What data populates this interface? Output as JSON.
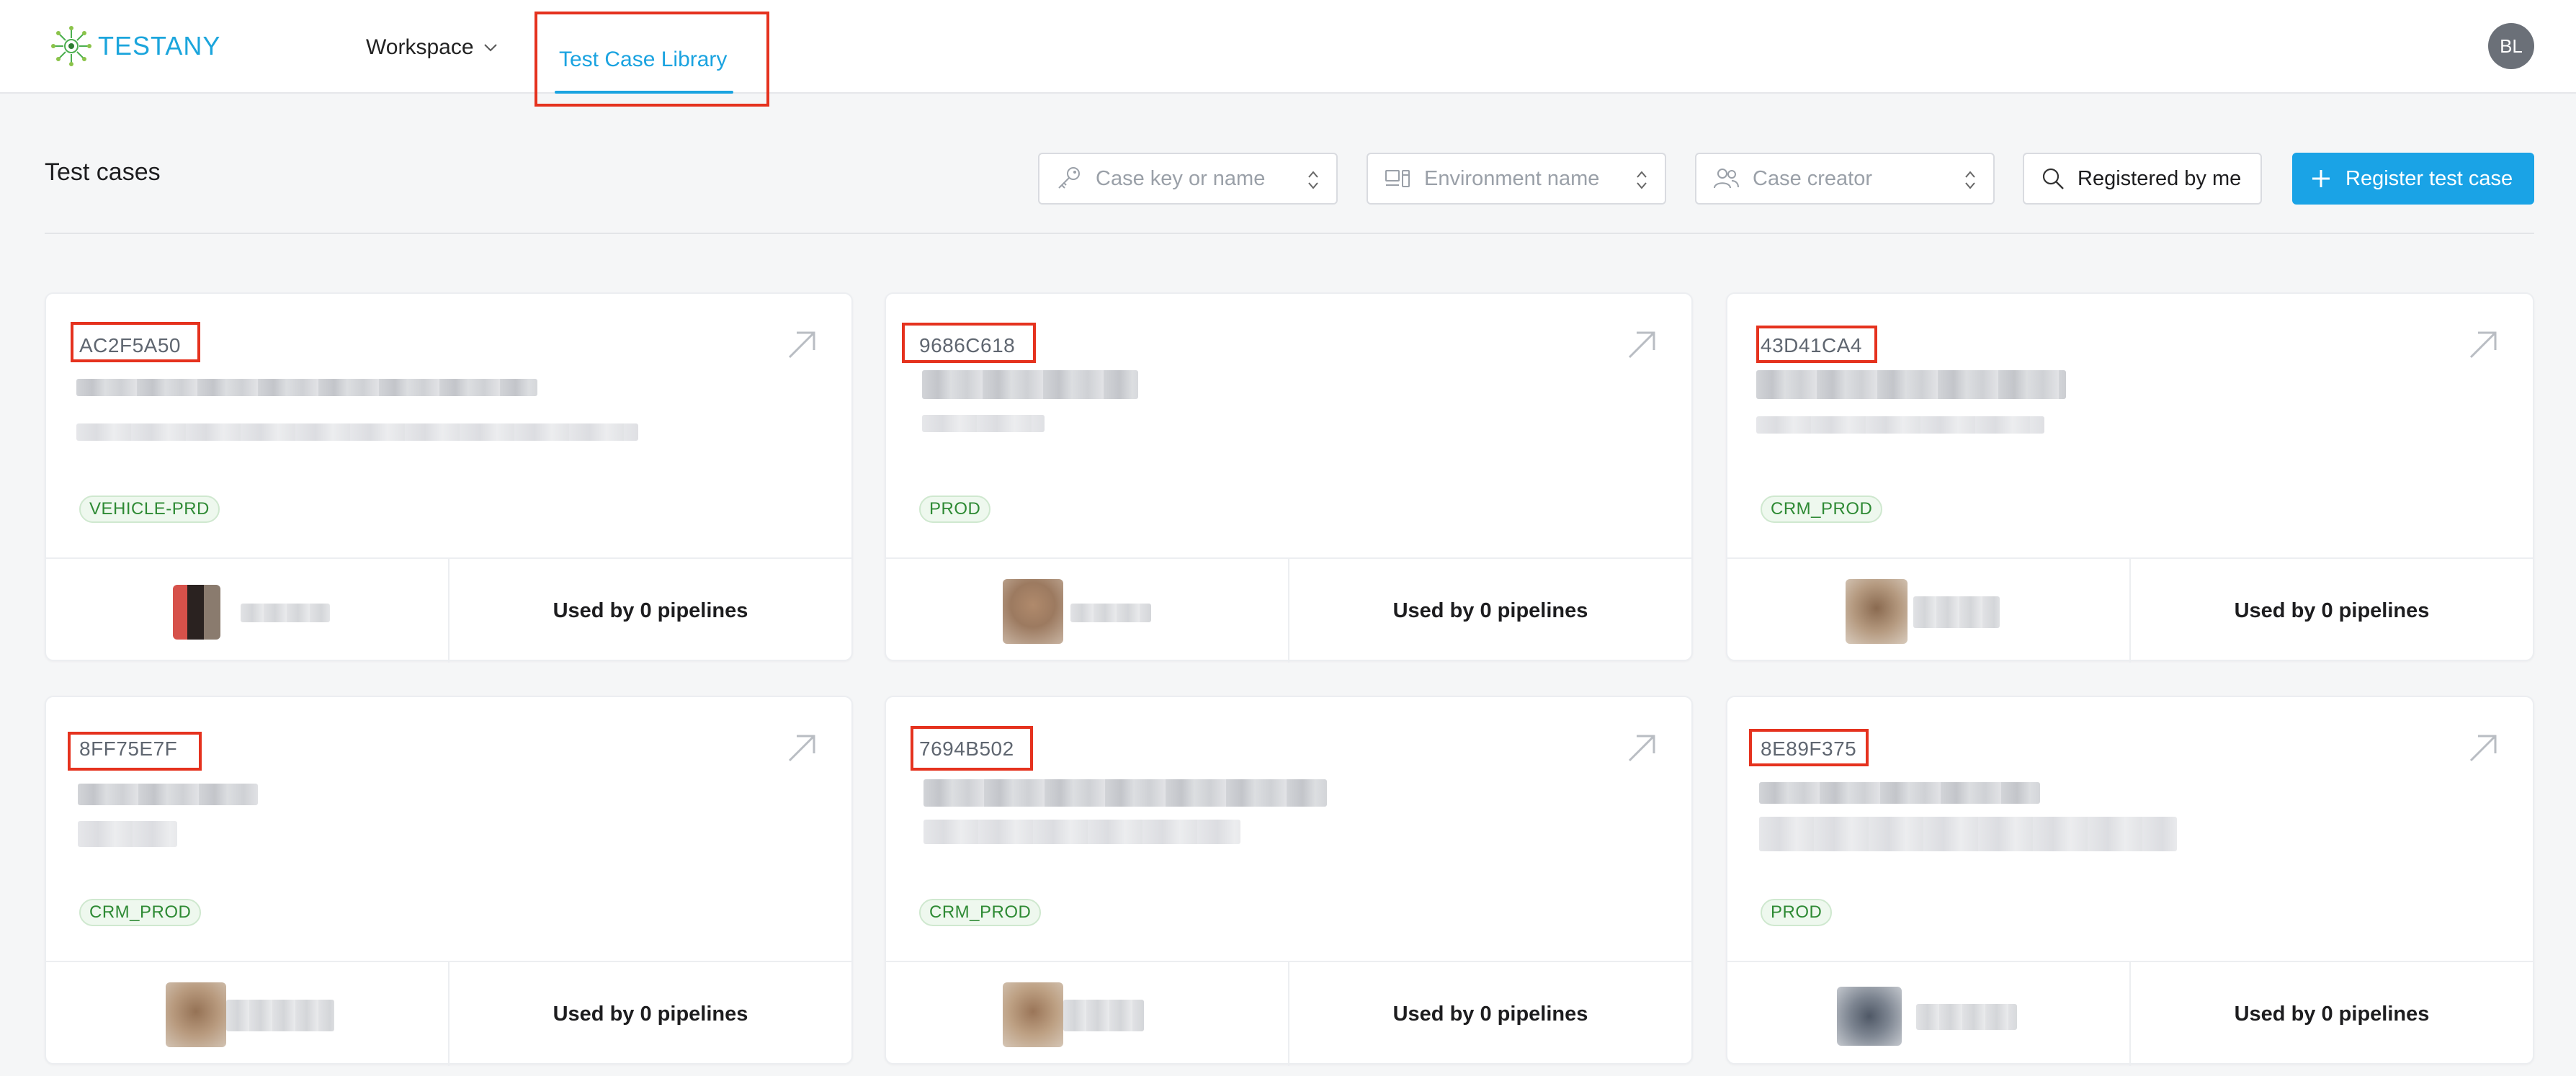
{
  "app": {
    "logo_text": "TESTANY",
    "nav_workspace": "Workspace",
    "nav_active_tab": "Test Case Library",
    "user_initials": "BL"
  },
  "toolbar": {
    "page_title": "Test cases",
    "filter_case_placeholder": "Case key or name",
    "filter_env_placeholder": "Environment name",
    "filter_creator_placeholder": "Case creator",
    "registered_label": "Registered by me",
    "register_label": "Register test case"
  },
  "colors": {
    "accent": "#1aa3e6",
    "highlight": "#e5321e",
    "badge_green": "#2e8a34"
  },
  "cards": [
    {
      "key": "AC2F5A50",
      "environment": "VEHICLE-PRD",
      "pipelines": "Used by 0 pipelines"
    },
    {
      "key": "9686C618",
      "environment": "PROD",
      "pipelines": "Used by 0 pipelines"
    },
    {
      "key": "43D41CA4",
      "environment": "CRM_PROD",
      "pipelines": "Used by 0 pipelines"
    },
    {
      "key": "8FF75E7F",
      "environment": "CRM_PROD",
      "pipelines": "Used by 0 pipelines"
    },
    {
      "key": "7694B502",
      "environment": "CRM_PROD",
      "pipelines": "Used by 0 pipelines"
    },
    {
      "key": "8E89F375",
      "environment": "PROD",
      "pipelines": "Used by 0 pipelines"
    }
  ]
}
